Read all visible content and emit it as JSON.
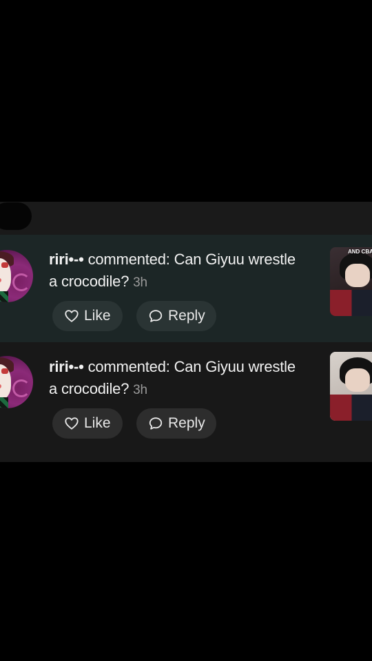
{
  "notifications": [
    {
      "username": "riri•-•",
      "message": " commented: Can Giyuu wrestle a crocodile?",
      "time": "3h",
      "like_label": "Like",
      "reply_label": "Reply",
      "thumbnail_caption": "AND CBAN"
    },
    {
      "username": "riri•-•",
      "message": " commented: Can Giyuu wrestle a crocodile?",
      "time": "3h",
      "like_label": "Like",
      "reply_label": "Reply"
    }
  ],
  "colors": {
    "background": "#000000",
    "highlight_row": "#1c2626",
    "row": "#181818",
    "button": "#2d2d2d",
    "text": "#f2f2f2",
    "muted_text": "#9a9a9a"
  },
  "icons": [
    "heart-icon",
    "comment-bubble-icon"
  ]
}
